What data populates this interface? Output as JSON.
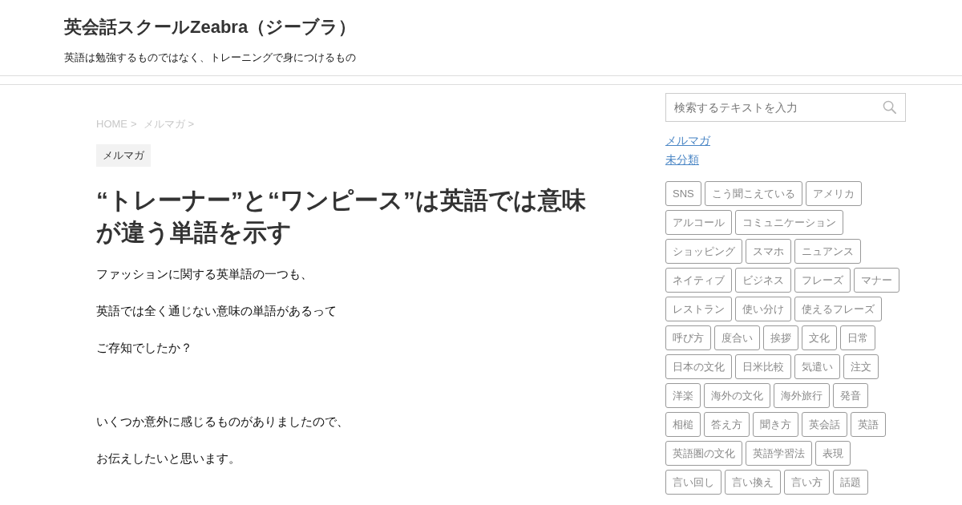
{
  "header": {
    "site_title": "英会話スクールZeabra（ジーブラ）",
    "tagline": "英語は勉強するものではなく、トレーニングで身につけるもの"
  },
  "breadcrumb": {
    "items": [
      "HOME",
      "メルマガ"
    ],
    "separator": ">"
  },
  "article": {
    "category": "メルマガ",
    "title": "“トレーナー”と“ワンピース”は英語では意味が違う単語を示す",
    "paragraph_groups": [
      [
        "ファッションに関する英単語の一つも、",
        "英語では全く通じない意味の単語があるって",
        "ご存知でしたか？"
      ],
      [
        "いくつか意外に感じるものがありましたので、",
        "お伝えしたいと思います。"
      ]
    ]
  },
  "sidebar": {
    "search": {
      "placeholder": "検索するテキストを入力"
    },
    "categories": [
      "メルマガ",
      "未分類"
    ],
    "tags": [
      "SNS",
      "こう聞こえている",
      "アメリカ",
      "アルコール",
      "コミュニケーション",
      "ショッピング",
      "スマホ",
      "ニュアンス",
      "ネイティブ",
      "ビジネス",
      "フレーズ",
      "マナー",
      "レストラン",
      "使い分け",
      "使えるフレーズ",
      "呼び方",
      "度合い",
      "挨拶",
      "文化",
      "日常",
      "日本の文化",
      "日米比較",
      "気遣い",
      "注文",
      "洋楽",
      "海外の文化",
      "海外旅行",
      "発音",
      "相槌",
      "答え方",
      "聞き方",
      "英会話",
      "英語",
      "英語圏の文化",
      "英語学習法",
      "表現",
      "言い回し",
      "言い換え",
      "言い方",
      "話題"
    ]
  }
}
